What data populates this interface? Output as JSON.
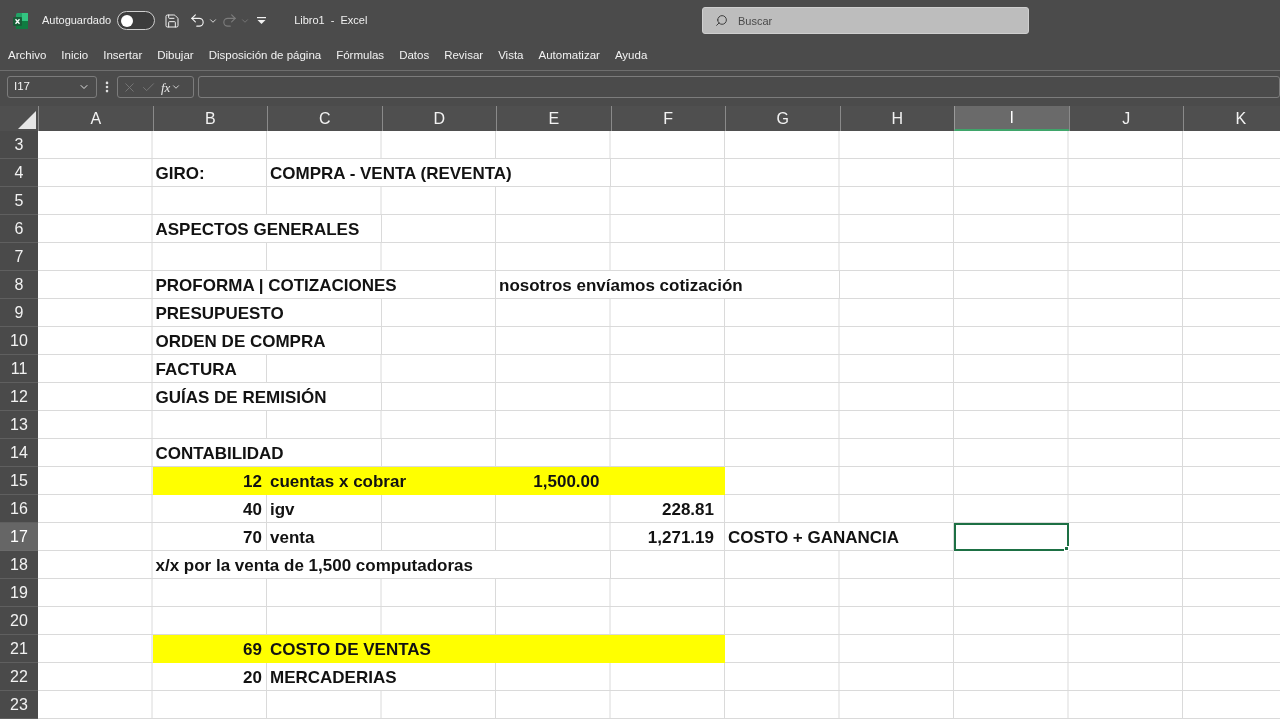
{
  "title_bar": {
    "autosave": {
      "label": "Autoguardado",
      "on": false
    },
    "quick_access": [
      {
        "kind": "save",
        "disabled": false
      },
      {
        "kind": "undo",
        "disabled": false
      },
      {
        "kind": "redo",
        "disabled": true
      },
      {
        "kind": "customize",
        "disabled": false
      }
    ],
    "title": "Libro1 - Excel",
    "search": {
      "placeholder": "Buscar"
    }
  },
  "menu": [
    "Archivo",
    "Inicio",
    "Insertar",
    "Dibujar",
    "Disposición de página",
    "Fórmulas",
    "Datos",
    "Revisar",
    "Vista",
    "Automatizar",
    "Ayuda"
  ],
  "formula_bar": {
    "name_box": "I17",
    "buttons": [
      {
        "kind": "cancel",
        "disabled": true
      },
      {
        "kind": "enter",
        "disabled": true
      }
    ],
    "function_label": "fx"
  },
  "columns": [
    "A",
    "B",
    "C",
    "D",
    "E",
    "F",
    "G",
    "H",
    "I",
    "J",
    "K"
  ],
  "rows": [
    {
      "number": "3",
      "cells": [
        {
          "selected": false,
          "highlighted": false
        },
        {
          "selected": false,
          "highlighted": false
        },
        {
          "selected": false,
          "highlighted": false
        },
        {
          "selected": false,
          "highlighted": false
        },
        {
          "selected": false,
          "highlighted": false
        },
        {
          "selected": false,
          "highlighted": false
        },
        {
          "selected": false,
          "highlighted": false
        },
        {
          "selected": false,
          "highlighted": false
        },
        {
          "selected": false,
          "highlighted": false
        },
        {
          "selected": false,
          "highlighted": false
        },
        {
          "selected": false,
          "highlighted": false
        }
      ]
    },
    {
      "number": "4",
      "cells": [
        {
          "selected": false,
          "highlighted": false
        },
        {
          "kind": "text",
          "text": "GIRO:",
          "selected": false,
          "highlighted": false
        },
        {
          "kind": "text",
          "text": "COMPRA - VENTA (REVENTA)",
          "selected": false,
          "highlighted": false
        },
        {
          "selected": false,
          "highlighted": false
        },
        {
          "selected": false,
          "highlighted": false
        },
        {
          "selected": false,
          "highlighted": false
        },
        {
          "selected": false,
          "highlighted": false
        },
        {
          "selected": false,
          "highlighted": false
        },
        {
          "selected": false,
          "highlighted": false
        }
      ]
    },
    {
      "number": "5",
      "cells": [
        {
          "selected": false,
          "highlighted": false
        },
        {
          "selected": false,
          "highlighted": false
        },
        {
          "selected": false,
          "highlighted": false
        },
        {
          "selected": false,
          "highlighted": false
        },
        {
          "selected": false,
          "highlighted": false
        },
        {
          "selected": false,
          "highlighted": false
        },
        {
          "selected": false,
          "highlighted": false
        },
        {
          "selected": false,
          "highlighted": false
        },
        {
          "selected": false,
          "highlighted": false
        },
        {
          "selected": false,
          "highlighted": false
        },
        {
          "selected": false,
          "highlighted": false
        }
      ]
    },
    {
      "number": "6",
      "cells": [
        {
          "selected": false,
          "highlighted": false
        },
        {
          "kind": "text",
          "text": "ASPECTOS GENERALES",
          "selected": false,
          "highlighted": false
        },
        {
          "selected": false,
          "highlighted": false
        },
        {
          "selected": false,
          "highlighted": false
        },
        {
          "selected": false,
          "highlighted": false
        },
        {
          "selected": false,
          "highlighted": false
        },
        {
          "selected": false,
          "highlighted": false
        },
        {
          "selected": false,
          "highlighted": false
        },
        {
          "selected": false,
          "highlighted": false
        },
        {
          "selected": false,
          "highlighted": false
        }
      ]
    },
    {
      "number": "7",
      "cells": [
        {
          "selected": false,
          "highlighted": false
        },
        {
          "selected": false,
          "highlighted": false
        },
        {
          "selected": false,
          "highlighted": false
        },
        {
          "selected": false,
          "highlighted": false
        },
        {
          "selected": false,
          "highlighted": false
        },
        {
          "selected": false,
          "highlighted": false
        },
        {
          "selected": false,
          "highlighted": false
        },
        {
          "selected": false,
          "highlighted": false
        },
        {
          "selected": false,
          "highlighted": false
        },
        {
          "selected": false,
          "highlighted": false
        },
        {
          "selected": false,
          "highlighted": false
        }
      ]
    },
    {
      "number": "8",
      "cells": [
        {
          "selected": false,
          "highlighted": false
        },
        {
          "kind": "text",
          "text": "PROFORMA | COTIZACIONES",
          "selected": false,
          "highlighted": false
        },
        {
          "kind": "text",
          "text": "nosotros envíamos cotización",
          "selected": false,
          "highlighted": false
        },
        {
          "selected": false,
          "highlighted": false
        },
        {
          "selected": false,
          "highlighted": false
        },
        {
          "selected": false,
          "highlighted": false
        },
        {
          "selected": false,
          "highlighted": false
        }
      ]
    },
    {
      "number": "9",
      "cells": [
        {
          "selected": false,
          "highlighted": false
        },
        {
          "kind": "text",
          "text": "PRESUPUESTO",
          "selected": false,
          "highlighted": false
        },
        {
          "selected": false,
          "highlighted": false
        },
        {
          "selected": false,
          "highlighted": false
        },
        {
          "selected": false,
          "highlighted": false
        },
        {
          "selected": false,
          "highlighted": false
        },
        {
          "selected": false,
          "highlighted": false
        },
        {
          "selected": false,
          "highlighted": false
        },
        {
          "selected": false,
          "highlighted": false
        },
        {
          "selected": false,
          "highlighted": false
        }
      ]
    },
    {
      "number": "10",
      "cells": [
        {
          "selected": false,
          "highlighted": false
        },
        {
          "kind": "text",
          "text": "ORDEN DE COMPRA",
          "selected": false,
          "highlighted": false
        },
        {
          "selected": false,
          "highlighted": false
        },
        {
          "selected": false,
          "highlighted": false
        },
        {
          "selected": false,
          "highlighted": false
        },
        {
          "selected": false,
          "highlighted": false
        },
        {
          "selected": false,
          "highlighted": false
        },
        {
          "selected": false,
          "highlighted": false
        },
        {
          "selected": false,
          "highlighted": false
        },
        {
          "selected": false,
          "highlighted": false
        }
      ]
    },
    {
      "number": "11",
      "cells": [
        {
          "selected": false,
          "highlighted": false
        },
        {
          "kind": "text",
          "text": "FACTURA",
          "selected": false,
          "highlighted": false
        },
        {
          "selected": false,
          "highlighted": false
        },
        {
          "selected": false,
          "highlighted": false
        },
        {
          "selected": false,
          "highlighted": false
        },
        {
          "selected": false,
          "highlighted": false
        },
        {
          "selected": false,
          "highlighted": false
        },
        {
          "selected": false,
          "highlighted": false
        },
        {
          "selected": false,
          "highlighted": false
        },
        {
          "selected": false,
          "highlighted": false
        },
        {
          "selected": false,
          "highlighted": false
        }
      ]
    },
    {
      "number": "12",
      "cells": [
        {
          "selected": false,
          "highlighted": false
        },
        {
          "kind": "text",
          "text": "GUÍAS DE REMISIÓN",
          "selected": false,
          "highlighted": false
        },
        {
          "selected": false,
          "highlighted": false
        },
        {
          "selected": false,
          "highlighted": false
        },
        {
          "selected": false,
          "highlighted": false
        },
        {
          "selected": false,
          "highlighted": false
        },
        {
          "selected": false,
          "highlighted": false
        },
        {
          "selected": false,
          "highlighted": false
        },
        {
          "selected": false,
          "highlighted": false
        },
        {
          "selected": false,
          "highlighted": false
        }
      ]
    },
    {
      "number": "13",
      "cells": [
        {
          "selected": false,
          "highlighted": false
        },
        {
          "selected": false,
          "highlighted": false
        },
        {
          "selected": false,
          "highlighted": false
        },
        {
          "selected": false,
          "highlighted": false
        },
        {
          "selected": false,
          "highlighted": false
        },
        {
          "selected": false,
          "highlighted": false
        },
        {
          "selected": false,
          "highlighted": false
        },
        {
          "selected": false,
          "highlighted": false
        },
        {
          "selected": false,
          "highlighted": false
        },
        {
          "selected": false,
          "highlighted": false
        },
        {
          "selected": false,
          "highlighted": false
        }
      ]
    },
    {
      "number": "14",
      "cells": [
        {
          "selected": false,
          "highlighted": false
        },
        {
          "kind": "text",
          "text": "CONTABILIDAD",
          "selected": false,
          "highlighted": false
        },
        {
          "selected": false,
          "highlighted": false
        },
        {
          "selected": false,
          "highlighted": false
        },
        {
          "selected": false,
          "highlighted": false
        },
        {
          "selected": false,
          "highlighted": false
        },
        {
          "selected": false,
          "highlighted": false
        },
        {
          "selected": false,
          "highlighted": false
        },
        {
          "selected": false,
          "highlighted": false
        },
        {
          "selected": false,
          "highlighted": false
        }
      ]
    },
    {
      "number": "15",
      "cells": [
        {
          "selected": false,
          "highlighted": false
        },
        {
          "kind": "integer",
          "text": "12",
          "selected": false,
          "highlighted": true
        },
        {
          "kind": "text",
          "text": "cuentas x cobrar",
          "selected": false,
          "highlighted": true
        },
        {
          "kind": "amount",
          "text": "1,500.00",
          "selected": false,
          "highlighted": true
        },
        {
          "selected": false,
          "highlighted": true
        },
        {
          "selected": false,
          "highlighted": false
        },
        {
          "selected": false,
          "highlighted": false
        },
        {
          "selected": false,
          "highlighted": false
        },
        {
          "selected": false,
          "highlighted": false
        },
        {
          "selected": false,
          "highlighted": false
        }
      ]
    },
    {
      "number": "16",
      "cells": [
        {
          "selected": false,
          "highlighted": false
        },
        {
          "kind": "integer",
          "text": "40",
          "selected": false,
          "highlighted": false
        },
        {
          "kind": "text",
          "text": "igv",
          "selected": false,
          "highlighted": false
        },
        {
          "selected": false,
          "highlighted": false
        },
        {
          "selected": false,
          "highlighted": false
        },
        {
          "kind": "amount",
          "text": "228.81",
          "selected": false,
          "highlighted": false
        },
        {
          "selected": false,
          "highlighted": false
        },
        {
          "selected": false,
          "highlighted": false
        },
        {
          "selected": false,
          "highlighted": false
        },
        {
          "selected": false,
          "highlighted": false
        },
        {
          "selected": false,
          "highlighted": false
        }
      ]
    },
    {
      "number": "17",
      "cells": [
        {
          "selected": false,
          "highlighted": false
        },
        {
          "kind": "integer",
          "text": "70",
          "selected": false,
          "highlighted": false
        },
        {
          "kind": "text",
          "text": "venta",
          "selected": false,
          "highlighted": false
        },
        {
          "selected": false,
          "highlighted": false
        },
        {
          "selected": false,
          "highlighted": false
        },
        {
          "kind": "amount",
          "text": "1,271.19",
          "selected": false,
          "highlighted": false
        },
        {
          "kind": "text",
          "text": "COSTO + GANANCIA",
          "selected": false,
          "highlighted": false
        },
        {
          "selected": true,
          "highlighted": false
        },
        {
          "selected": false,
          "highlighted": false
        },
        {
          "selected": false,
          "highlighted": false
        }
      ]
    },
    {
      "number": "18",
      "cells": [
        {
          "selected": false,
          "highlighted": false
        },
        {
          "kind": "text",
          "text": "x/x por la venta de 1,500 computadoras",
          "selected": false,
          "highlighted": false
        },
        {
          "selected": false,
          "highlighted": false
        },
        {
          "selected": false,
          "highlighted": false
        },
        {
          "selected": false,
          "highlighted": false
        },
        {
          "selected": false,
          "highlighted": false
        },
        {
          "selected": false,
          "highlighted": false
        },
        {
          "selected": false,
          "highlighted": false
        }
      ]
    },
    {
      "number": "19",
      "cells": [
        {
          "selected": false,
          "highlighted": false
        },
        {
          "selected": false,
          "highlighted": false
        },
        {
          "selected": false,
          "highlighted": false
        },
        {
          "selected": false,
          "highlighted": false
        },
        {
          "selected": false,
          "highlighted": false
        },
        {
          "selected": false,
          "highlighted": false
        },
        {
          "selected": false,
          "highlighted": false
        },
        {
          "selected": false,
          "highlighted": false
        },
        {
          "selected": false,
          "highlighted": false
        },
        {
          "selected": false,
          "highlighted": false
        },
        {
          "selected": false,
          "highlighted": false
        }
      ]
    },
    {
      "number": "20",
      "cells": [
        {
          "selected": false,
          "highlighted": false
        },
        {
          "selected": false,
          "highlighted": false
        },
        {
          "selected": false,
          "highlighted": false
        },
        {
          "selected": false,
          "highlighted": false
        },
        {
          "selected": false,
          "highlighted": false
        },
        {
          "selected": false,
          "highlighted": false
        },
        {
          "selected": false,
          "highlighted": false
        },
        {
          "selected": false,
          "highlighted": false
        },
        {
          "selected": false,
          "highlighted": false
        },
        {
          "selected": false,
          "highlighted": false
        },
        {
          "selected": false,
          "highlighted": false
        }
      ]
    },
    {
      "number": "21",
      "cells": [
        {
          "selected": false,
          "highlighted": false
        },
        {
          "kind": "integer",
          "text": "69",
          "selected": false,
          "highlighted": true
        },
        {
          "kind": "text",
          "text": "COSTO DE VENTAS",
          "selected": false,
          "highlighted": true
        },
        {
          "selected": false,
          "highlighted": true
        },
        {
          "selected": false,
          "highlighted": true
        },
        {
          "selected": false,
          "highlighted": false
        },
        {
          "selected": false,
          "highlighted": false
        },
        {
          "selected": false,
          "highlighted": false
        },
        {
          "selected": false,
          "highlighted": false
        },
        {
          "selected": false,
          "highlighted": false
        }
      ]
    },
    {
      "number": "22",
      "cells": [
        {
          "selected": false,
          "highlighted": false
        },
        {
          "kind": "integer",
          "text": "20",
          "selected": false,
          "highlighted": false
        },
        {
          "kind": "text",
          "text": "MERCADERIAS",
          "selected": false,
          "highlighted": false
        },
        {
          "selected": false,
          "highlighted": false
        },
        {
          "selected": false,
          "highlighted": false
        },
        {
          "selected": false,
          "highlighted": false
        },
        {
          "selected": false,
          "highlighted": false
        },
        {
          "selected": false,
          "highlighted": false
        },
        {
          "selected": false,
          "highlighted": false
        },
        {
          "selected": false,
          "highlighted": false
        }
      ]
    },
    {
      "number": "23",
      "cells": [
        {
          "selected": false,
          "highlighted": false
        },
        {
          "selected": false,
          "highlighted": false
        },
        {
          "selected": false,
          "highlighted": false
        },
        {
          "selected": false,
          "highlighted": false
        },
        {
          "selected": false,
          "highlighted": false
        },
        {
          "selected": false,
          "highlighted": false
        },
        {
          "selected": false,
          "highlighted": false
        },
        {
          "selected": false,
          "highlighted": false
        },
        {
          "selected": false,
          "highlighted": false
        },
        {
          "selected": false,
          "highlighted": false
        },
        {
          "selected": false,
          "highlighted": false
        }
      ]
    }
  ]
}
